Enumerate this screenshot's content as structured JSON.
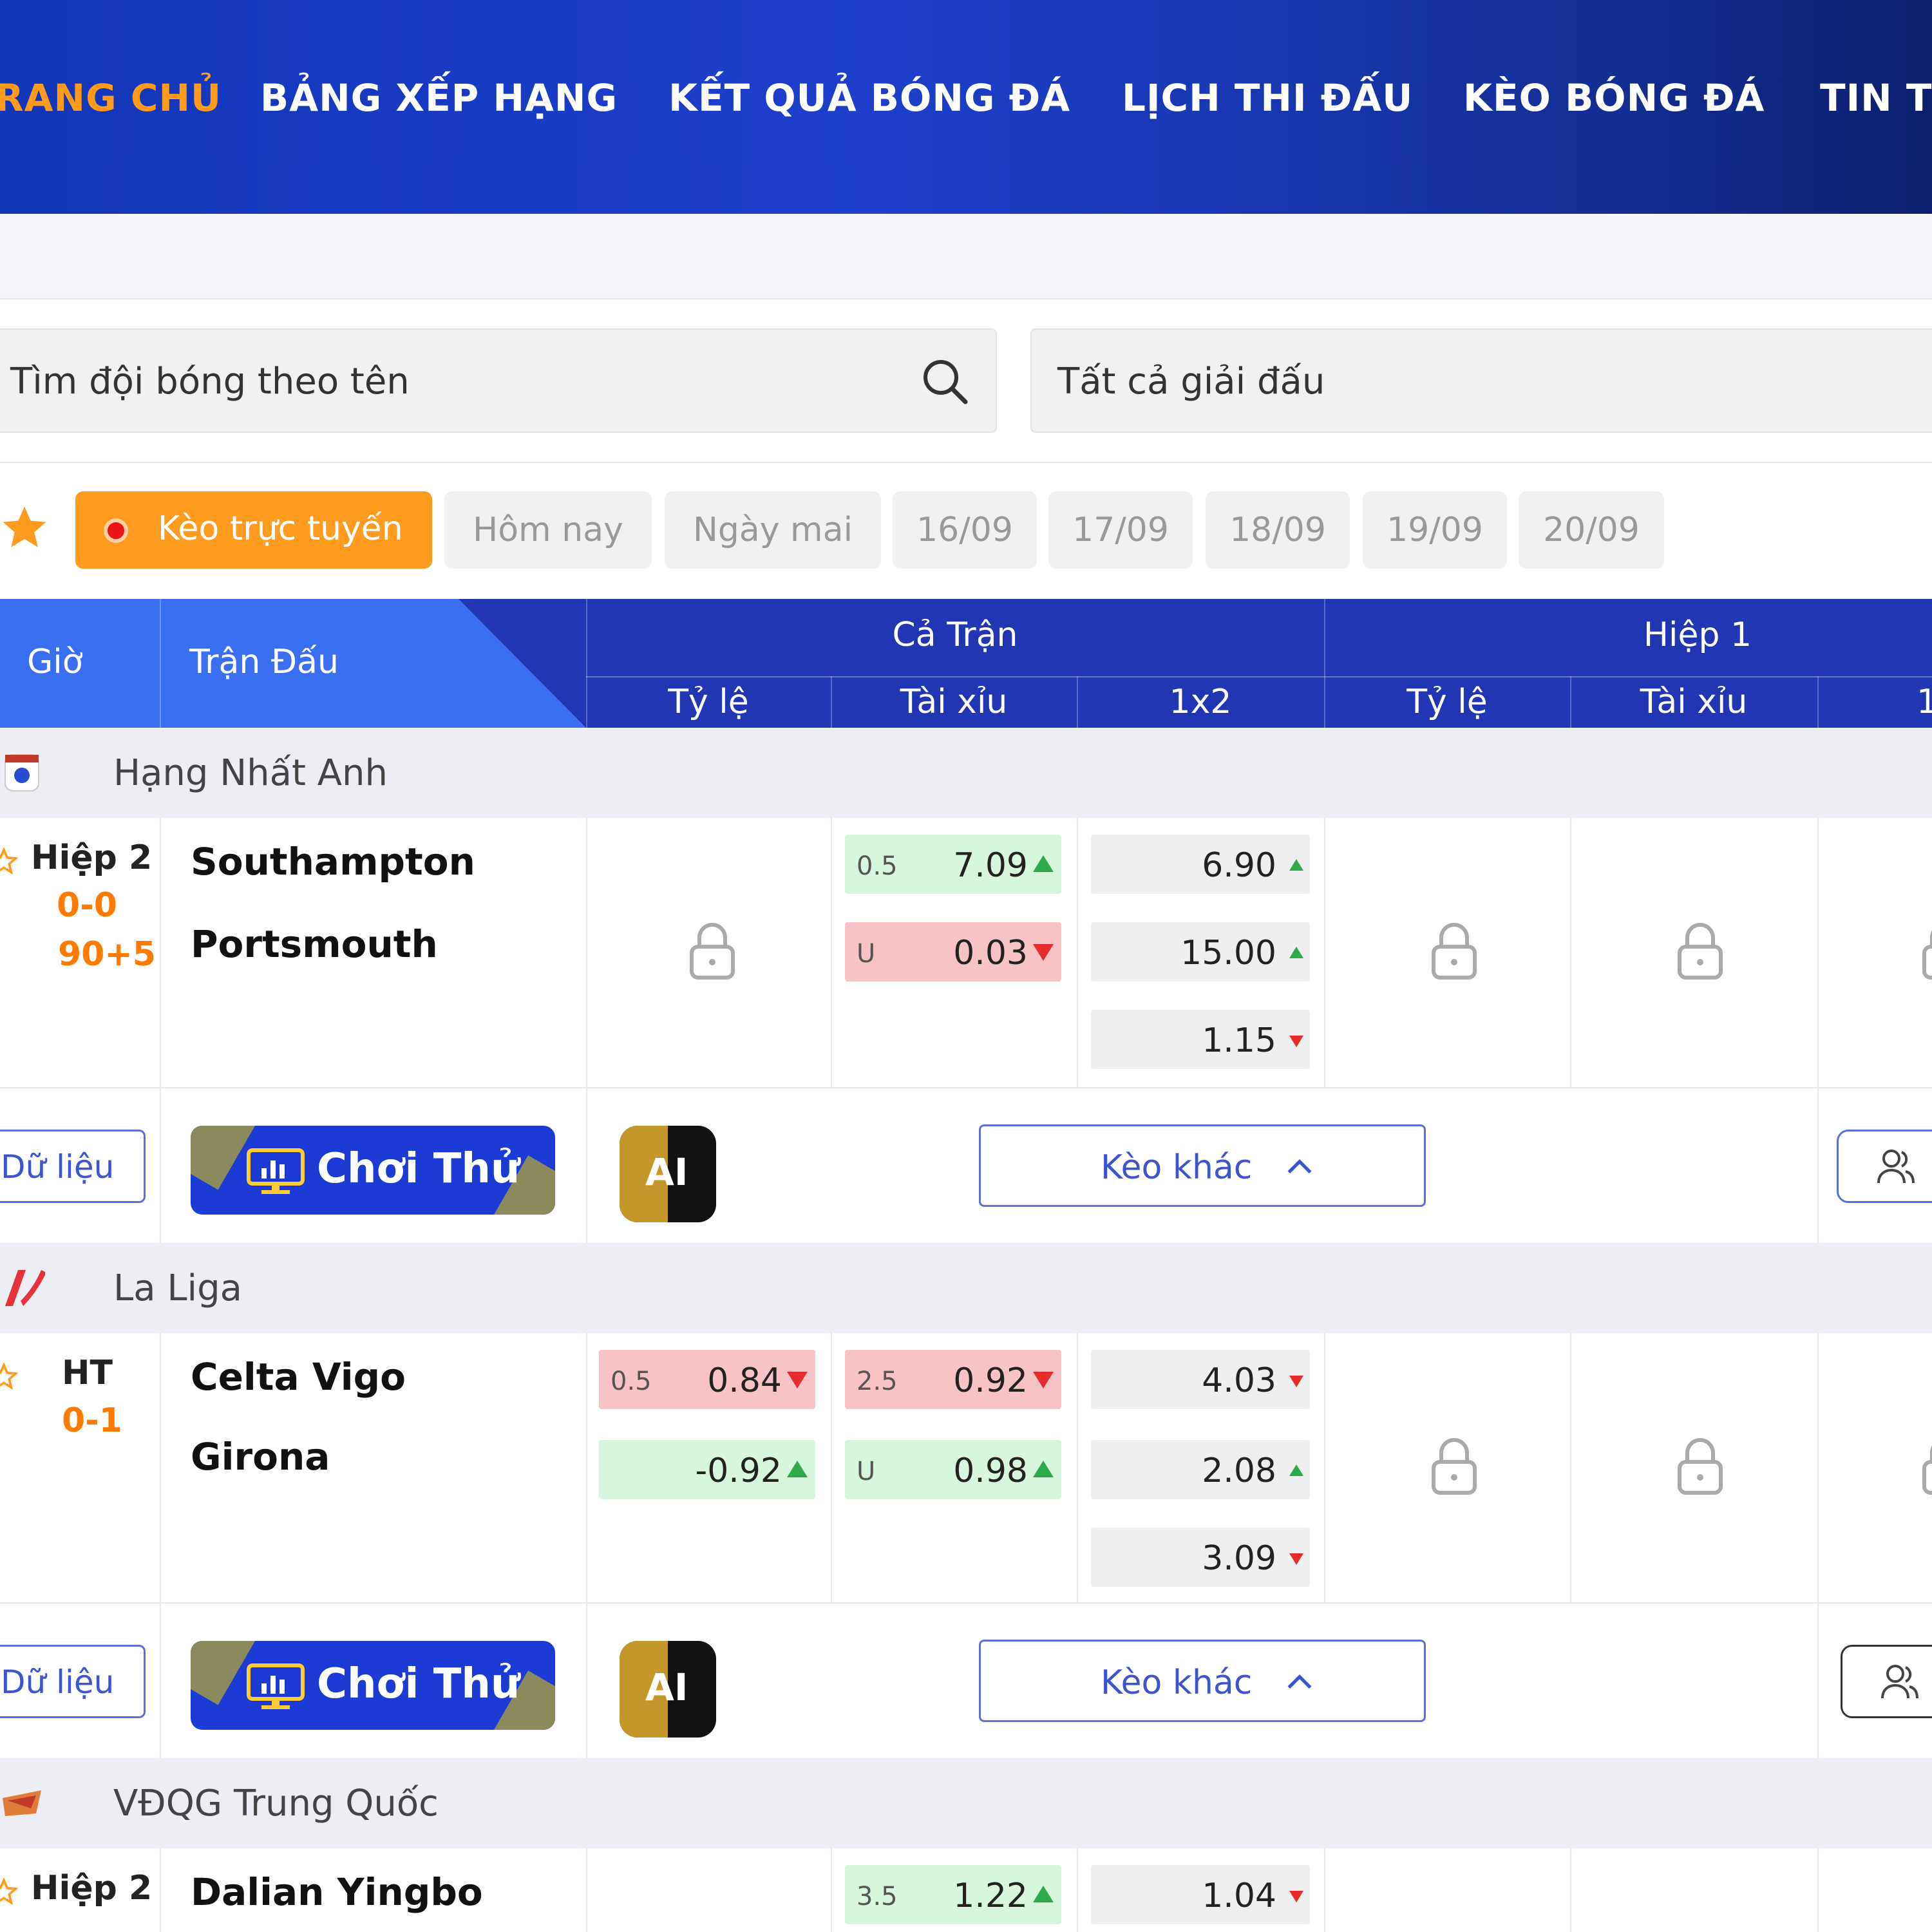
{
  "nav": {
    "items": [
      "RANG CHỦ",
      "BẢNG XẾP HẠNG",
      "KẾT QUẢ BÓNG ĐÁ",
      "LỊCH THI ĐẤU",
      "KÈO BÓNG ĐÁ",
      "TIN TỨ"
    ]
  },
  "search": {
    "placeholder": "Tìm đội bóng theo tên"
  },
  "league_filter": {
    "value": "Tất cả giải đấu"
  },
  "tabs": {
    "live": "Kèo trực tuyến",
    "dates": [
      "Hôm nay",
      "Ngày mai",
      "16/09",
      "17/09",
      "18/09",
      "19/09",
      "20/09"
    ]
  },
  "table_header": {
    "time": "Giờ",
    "match": "Trận Đấu",
    "full_match": "Cả Trận",
    "first_half": "Hiệp 1",
    "cols": [
      "Tỷ lệ",
      "Tài xỉu",
      "1x2",
      "Tỷ lệ",
      "Tài xỉu",
      "1"
    ]
  },
  "buttons": {
    "data": "Dữ liệu",
    "try": "Chơi Thử",
    "ai": "AI",
    "other": "Kèo khác"
  },
  "leagues": [
    {
      "name": "Hạng Nhất Anh",
      "match": {
        "status": "Hiệp 2",
        "score": "0-0",
        "minute": "90+5",
        "home": "Southampton",
        "away": "Portsmouth",
        "ou": [
          {
            "line": "0.5",
            "val": "7.09"
          },
          {
            "line": "U",
            "val": "0.03"
          }
        ],
        "x12": [
          "6.90",
          "15.00",
          "1.15"
        ]
      }
    },
    {
      "name": "La Liga",
      "match": {
        "status": "HT",
        "score": "0-1",
        "home": "Celta Vigo",
        "away": "Girona",
        "hdp": [
          {
            "line": "0.5",
            "val": "0.84"
          },
          {
            "line": "",
            "val": "-0.92"
          }
        ],
        "ou": [
          {
            "line": "2.5",
            "val": "0.92"
          },
          {
            "line": "U",
            "val": "0.98"
          }
        ],
        "x12": [
          "4.03",
          "2.08",
          "3.09"
        ]
      }
    },
    {
      "name": "VĐQG Trung Quốc",
      "match": {
        "status": "Hiệp 2",
        "home": "Dalian Yingbo",
        "ou": [
          {
            "line": "3.5",
            "val": "1.22"
          }
        ],
        "x12": [
          "1.04"
        ]
      }
    }
  ],
  "colors": {
    "nav_bg": "#1d3fcc",
    "accent_orange": "#ff9b1f",
    "header_blue": "#2236b3",
    "odd_up": "#2eaa4a",
    "odd_down": "#e52b2b"
  }
}
